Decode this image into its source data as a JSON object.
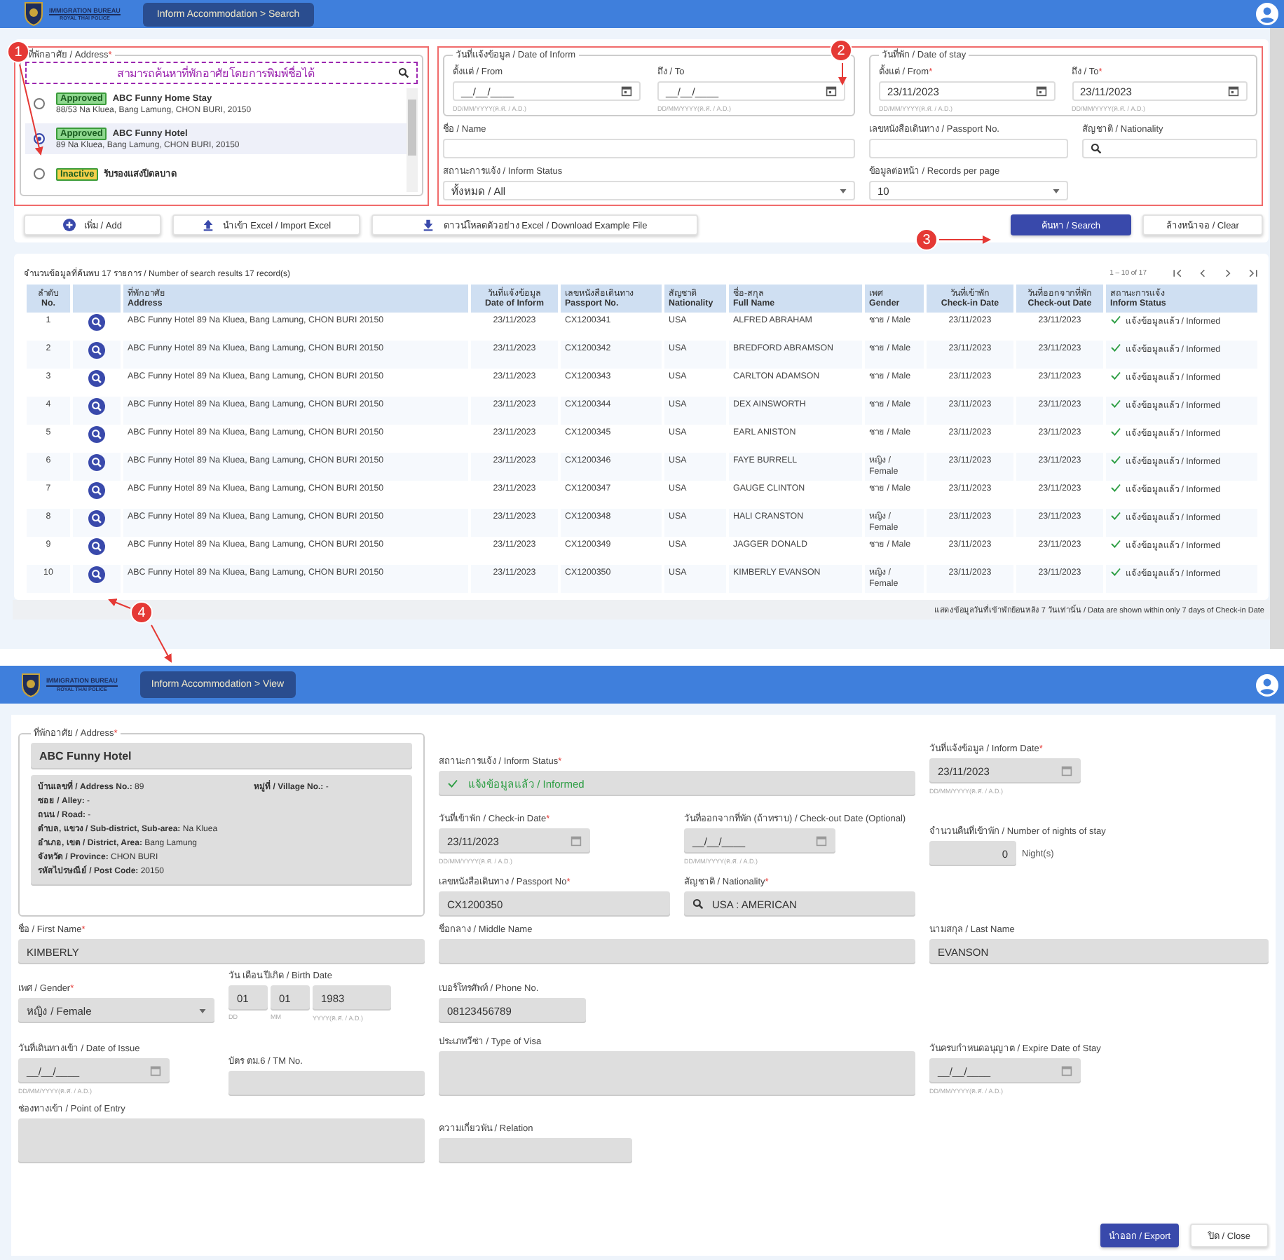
{
  "search_screen": {
    "header": {
      "logo_title": "IMMIGRATION BUREAU",
      "logo_subtitle": "ROYAL THAI POLICE",
      "breadcrumb": "Inform Accommodation > Search"
    },
    "address_panel": {
      "label": "ที่พักอาศัย / Address",
      "mark": "*",
      "search_placeholder": "สามารถค้นหาที่พักอาศัยโดยการพิมพ์ชื่อได้",
      "items": [
        {
          "status": "Approved",
          "color": "#8fd88f",
          "name": "ABC Funny Home Stay",
          "address": "88/53 Na Kluea, Bang Lamung, CHON BURI, 20150",
          "selected": false
        },
        {
          "status": "Approved",
          "color": "#8fd88f",
          "name": "ABC Funny Hotel",
          "address": "89 Na Kluea, Bang Lamung, CHON BURI, 20150",
          "selected": true
        },
        {
          "status": "Inactive",
          "color": "#f6d04a",
          "name": "รับรองแสงปีตลบาด",
          "selected": false
        }
      ]
    },
    "criteria": {
      "date_groups": [
        {
          "label": "วันที่แจ้งข้อมูล / Date of Inform",
          "fields": [
            {
              "label": "ตั้งแต่ / From",
              "value": "__/__/____",
              "hint": "DD/MM/YYYY(ค.ศ. / A.D.)"
            },
            {
              "label": "ถึง / To",
              "value": "__/__/____",
              "hint": "DD/MM/YYYY(ค.ศ. / A.D.)"
            }
          ]
        },
        {
          "label": "วันที่พัก / Date of stay",
          "fields": [
            {
              "label": "ตั้งแต่ / From",
              "mark": "*",
              "value": "23/11/2023",
              "hint": "DD/MM/YYYY(ค.ศ. / A.D.)"
            },
            {
              "label": "ถึง / To",
              "mark": "*",
              "value": "23/11/2023",
              "hint": "DD/MM/YYYY(ค.ศ. / A.D.)"
            }
          ]
        }
      ],
      "name_label": "ชื่อ / Name",
      "passport_label": "เลขหนังสือเดินทาง / Passport No.",
      "nationality_label": "สัญชาติ / Nationality",
      "status_label": "สถานะการแจ้ง / Inform Status",
      "status_value": "ทั้งหมด / All",
      "records_label": "ข้อมูลต่อหน้า / Records per page",
      "records_value": "10"
    },
    "buttons": {
      "add": "เพิ่ม / Add",
      "import": "นำเข้า Excel / Import Excel",
      "download": "ดาวน์โหลดตัวอย่าง Excel / Download Example File",
      "search": "ค้นหา / Search",
      "clear": "ล้างหน้าจอ / Clear"
    },
    "results": {
      "count": "จำนวนข้อมูลที่ค้นพบ 17 รายการ / Number of search results 17 record(s)",
      "range": "1 – 10 of 17",
      "columns": [
        {
          "thai": "ลำดับ",
          "english": "No."
        },
        {
          "thai": "ที่พักอาศัย",
          "english": "Address"
        },
        {
          "thai": "วันที่แจ้งข้อมูล",
          "english": "Date of Inform"
        },
        {
          "thai": "เลขหนังสือเดินทาง",
          "english": "Passport No."
        },
        {
          "thai": "สัญชาติ",
          "english": "Nationality"
        },
        {
          "thai": "ชื่อ-สกุล",
          "english": "Full Name"
        },
        {
          "thai": "เพศ",
          "english": "Gender"
        },
        {
          "thai": "วันที่เข้าพัก",
          "english": "Check-in Date"
        },
        {
          "thai": "วันที่ออกจากที่พัก",
          "english": "Check-out Date"
        },
        {
          "thai": "สถานะการแจ้ง",
          "english": "Inform Status"
        }
      ],
      "rows": [
        [
          "1",
          "ABC Funny Hotel 89 Na Kluea, Bang Lamung, CHON BURI 20150",
          "23/11/2023",
          "CX1200341",
          "USA",
          "ALFRED ABRAHAM",
          "ชาย / Male",
          "23/11/2023",
          "23/11/2023",
          "แจ้งข้อมูลแล้ว / Informed"
        ],
        [
          "2",
          "ABC Funny Hotel 89 Na Kluea, Bang Lamung, CHON BURI 20150",
          "23/11/2023",
          "CX1200342",
          "USA",
          "BREDFORD ABRAMSON",
          "ชาย / Male",
          "23/11/2023",
          "23/11/2023",
          "แจ้งข้อมูลแล้ว / Informed"
        ],
        [
          "3",
          "ABC Funny Hotel 89 Na Kluea, Bang Lamung, CHON BURI 20150",
          "23/11/2023",
          "CX1200343",
          "USA",
          "CARLTON ADAMSON",
          "ชาย / Male",
          "23/11/2023",
          "23/11/2023",
          "แจ้งข้อมูลแล้ว / Informed"
        ],
        [
          "4",
          "ABC Funny Hotel 89 Na Kluea, Bang Lamung, CHON BURI 20150",
          "23/11/2023",
          "CX1200344",
          "USA",
          "DEX AINSWORTH",
          "ชาย / Male",
          "23/11/2023",
          "23/11/2023",
          "แจ้งข้อมูลแล้ว / Informed"
        ],
        [
          "5",
          "ABC Funny Hotel 89 Na Kluea, Bang Lamung, CHON BURI 20150",
          "23/11/2023",
          "CX1200345",
          "USA",
          "EARL ANISTON",
          "ชาย / Male",
          "23/11/2023",
          "23/11/2023",
          "แจ้งข้อมูลแล้ว / Informed"
        ],
        [
          "6",
          "ABC Funny Hotel 89 Na Kluea, Bang Lamung, CHON BURI 20150",
          "23/11/2023",
          "CX1200346",
          "USA",
          "FAYE BURRELL",
          "หญิง / Female",
          "23/11/2023",
          "23/11/2023",
          "แจ้งข้อมูลแล้ว / Informed"
        ],
        [
          "7",
          "ABC Funny Hotel 89 Na Kluea, Bang Lamung, CHON BURI 20150",
          "23/11/2023",
          "CX1200347",
          "USA",
          "GAUGE CLINTON",
          "ชาย / Male",
          "23/11/2023",
          "23/11/2023",
          "แจ้งข้อมูลแล้ว / Informed"
        ],
        [
          "8",
          "ABC Funny Hotel 89 Na Kluea, Bang Lamung, CHON BURI 20150",
          "23/11/2023",
          "CX1200348",
          "USA",
          "HALI CRANSTON",
          "หญิง / Female",
          "23/11/2023",
          "23/11/2023",
          "แจ้งข้อมูลแล้ว / Informed"
        ],
        [
          "9",
          "ABC Funny Hotel 89 Na Kluea, Bang Lamung, CHON BURI 20150",
          "23/11/2023",
          "CX1200349",
          "USA",
          "JAGGER DONALD",
          "ชาย / Male",
          "23/11/2023",
          "23/11/2023",
          "แจ้งข้อมูลแล้ว / Informed"
        ],
        [
          "10",
          "ABC Funny Hotel 89 Na Kluea, Bang Lamung, CHON BURI 20150",
          "23/11/2023",
          "CX1200350",
          "USA",
          "KIMBERLY EVANSON",
          "หญิง / Female",
          "23/11/2023",
          "23/11/2023",
          "แจ้งข้อมูลแล้ว / Informed"
        ]
      ]
    },
    "note": "แสดงข้อมูลวันที่เข้าพักย้อนหลัง 7 วันเท่านั้น / Data are shown within only 7 days of Check-in Date"
  },
  "view_screen": {
    "header": {
      "logo_title": "IMMIGRATION BUREAU",
      "logo_subtitle": "ROYAL THAI POLICE",
      "breadcrumb": "Inform Accommodation > View"
    },
    "address": {
      "label": "ที่พักอาศัย / Address",
      "mark": "*",
      "name": "ABC Funny Hotel",
      "details": [
        "**บ้านเลขที่ / Address No.:** 89",
        "**หมู่ที่ / Village No.:** -",
        "**ซอย / Alley:** -",
        "**ถนน / Road:** -",
        "**ตำบล, แขวง / Sub-district, Sub-area:** Na Kluea",
        "**อำเภอ, เขต / District, Area:** Bang Lamung",
        "**จังหวัด / Province:** CHON BURI",
        "**รหัสไปรษณีย์ / Post Code:** 20150"
      ]
    },
    "fields": [
      {
        "kind": "status",
        "label": "สถานะการแจ้ง / Inform Status",
        "mark": "*",
        "value": "แจ้งข้อมูลแล้ว / Informed"
      },
      {
        "kind": "date",
        "label": "วันที่แจ้งข้อมูล / Inform Date",
        "mark": "*",
        "value": "23/11/2023",
        "hint": "DD/MM/YYYY(ค.ศ. / A.D.)"
      },
      {
        "kind": "date",
        "label": "วันที่เข้าพัก / Check-in Date",
        "mark": "*",
        "value": "23/11/2023",
        "hint": "DD/MM/YYYY(ค.ศ. / A.D.)"
      },
      {
        "kind": "date",
        "label": "วันที่ออกจากที่พัก (ถ้าทราบ) / Check-out Date (Optional)",
        "value": "__/__/____",
        "hint": "DD/MM/YYYY(ค.ศ. / A.D.)"
      },
      {
        "kind": "nights",
        "label": "จำนวนคืนที่เข้าพัก / Number of nights of stay",
        "value": "0",
        "unit": "Night(s)"
      },
      {
        "kind": "text",
        "label": "เลขหนังสือเดินทาง / Passport No",
        "mark": "*",
        "value": "CX1200350"
      },
      {
        "kind": "lookup",
        "label": "สัญชาติ / Nationality",
        "mark": "*",
        "value": "USA : AMERICAN"
      },
      {
        "kind": "text",
        "label": "ชื่อ / First Name",
        "mark": "*",
        "value": "KIMBERLY"
      },
      {
        "kind": "text",
        "label": "ชื่อกลาง / Middle Name"
      },
      {
        "kind": "text",
        "label": "นามสกุล / Last Name",
        "value": "EVANSON"
      },
      {
        "kind": "select",
        "label": "เพศ / Gender",
        "mark": "*",
        "value": "หญิง / Female"
      },
      {
        "kind": "birth",
        "label": "วัน เดือน ปีเกิด / Birth Date",
        "parts": [
          {
            "value": "01",
            "hint": "DD"
          },
          {
            "value": "01",
            "hint": "MM"
          },
          {
            "value": "1983",
            "hint": "YYYY(ค.ศ. / A.D.)"
          }
        ]
      },
      {
        "kind": "text",
        "label": "เบอร์โทรศัพท์ / Phone No.",
        "value": "08123456789"
      },
      {
        "kind": "date",
        "label": "วันที่เดินทางเข้า / Date of Issue",
        "value": "__/__/____",
        "hint": "DD/MM/YYYY(ค.ศ. / A.D.)"
      },
      {
        "kind": "text",
        "label": "บัตร ตม.6 / TM No."
      },
      {
        "kind": "area",
        "label": "ประเภทวีซ่า / Type of Visa"
      },
      {
        "kind": "date",
        "label": "วันครบกำหนดอนุญาต / Expire Date of Stay",
        "value": "__/__/____",
        "hint": "DD/MM/YYYY(ค.ศ. / A.D.)"
      },
      {
        "kind": "area",
        "label": "ช่องทางเข้า / Point of Entry"
      },
      {
        "kind": "text",
        "label": "ความเกี่ยวพัน / Relation"
      }
    ],
    "buttons": {
      "export": "นำออก / Export",
      "close": "ปิด / Close"
    }
  },
  "callouts": [
    {
      "number": "1"
    },
    {
      "number": "2"
    },
    {
      "number": "3"
    },
    {
      "number": "4"
    }
  ]
}
